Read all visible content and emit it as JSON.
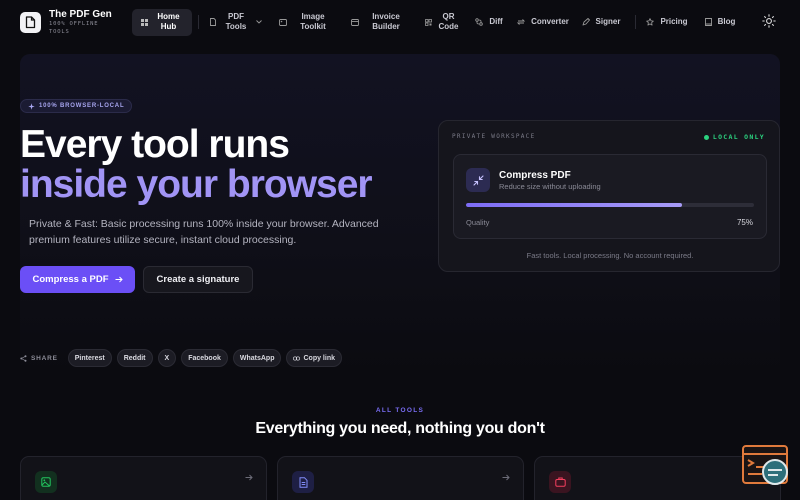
{
  "brand": {
    "title": "The PDF Gen",
    "subtitle": "100% OFFLINE TOOLS"
  },
  "nav": {
    "items": [
      {
        "label": "Home Hub",
        "icon": "grid-icon",
        "active": true
      },
      {
        "label": "PDF Tools",
        "icon": "document-icon",
        "dropdown": true
      },
      {
        "label": "Image Toolkit",
        "icon": "image-icon"
      },
      {
        "label": "Invoice Builder",
        "icon": "invoice-icon"
      },
      {
        "label": "QR Code",
        "icon": "qr-icon"
      },
      {
        "label": "Diff",
        "icon": "diff-icon"
      },
      {
        "label": "Converter",
        "icon": "converter-icon"
      },
      {
        "label": "Signer",
        "icon": "pen-icon"
      },
      {
        "label": "Pricing",
        "icon": "star-icon"
      },
      {
        "label": "Blog",
        "icon": "book-icon"
      }
    ],
    "theme_toggle": "sun-icon"
  },
  "hero": {
    "badge": "100% BROWSER-LOCAL",
    "title_line1": "Every tool runs",
    "title_line2": "inside your browser",
    "description": "Private & Fast: Basic processing runs 100% inside your browser. Advanced premium features utilize secure, instant cloud processing.",
    "primary_button": "Compress a PDF",
    "secondary_button": "Create a signature"
  },
  "workspace": {
    "label": "PRIVATE WORKSPACE",
    "status": "LOCAL ONLY",
    "tool_name": "Compress PDF",
    "tool_subtitle": "Reduce size without uploading",
    "quality_label": "Quality",
    "quality_value": "75%",
    "quality_fraction": 0.75,
    "footer": "Fast tools. Local processing. No account required."
  },
  "share": {
    "label": "SHARE",
    "items": [
      "Pinterest",
      "Reddit",
      "X",
      "Facebook",
      "WhatsApp",
      "Copy link"
    ]
  },
  "all_tools": {
    "label": "ALL TOOLS",
    "title": "Everything you need, nothing you don't"
  },
  "colors": {
    "accent": "#6b4ff6",
    "title_accent": "#a194f5",
    "local_green": "#2bd27f",
    "card_green": "#22c55e",
    "card_indigo": "#818cf8",
    "card_pink": "#f43f5e"
  }
}
